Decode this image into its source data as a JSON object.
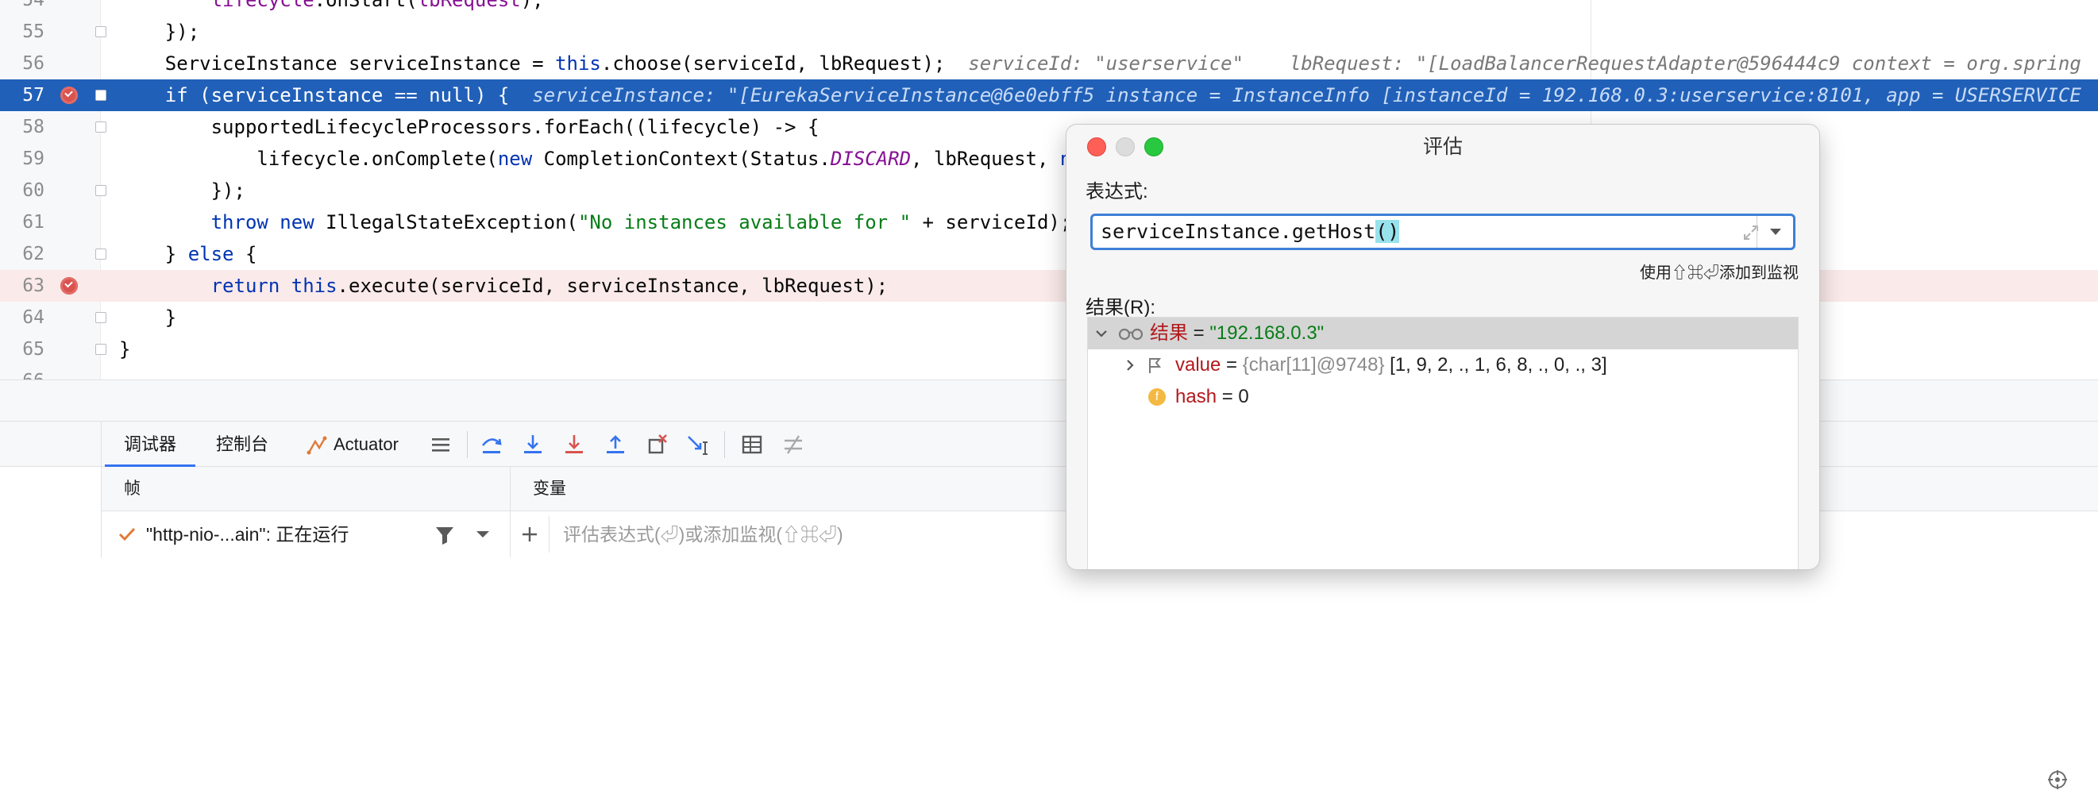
{
  "editor": {
    "lines": [
      {
        "num": "54",
        "code_html": "        <span class=\"var\">lifecycle</span>.onStart(<span class=\"var\">lbRequest</span>);"
      },
      {
        "num": "55",
        "code_html": "    });"
      },
      {
        "num": "56",
        "code_html": "    ServiceInstance serviceInstance = <span class=\"kw\">this</span>.choose(serviceId, lbRequest);  <span class=\"inline-hint\">serviceId: \"userservice\"    lbRequest: \"[LoadBalancerRequestAdapter@596444c9 context = org.spring</span>"
      },
      {
        "num": "57",
        "code_html": "    <span class=\"kw\">if</span> (serviceInstance == <span class=\"kw\">null</span>) {  <span class=\"inline-hint\">serviceInstance: \"[EurekaServiceInstance@6e0ebff5 instance = InstanceInfo [instanceId = 192.168.0.3:userservice:8101, app = USERSERVICE</span>"
      },
      {
        "num": "58",
        "code_html": "        supportedLifecycleProcessors.forEach((lifecycle) -> {"
      },
      {
        "num": "59",
        "code_html": "            lifecycle.onComplete(<span class=\"kw\">new</span> CompletionContext(Status.<span class=\"field\">DISCARD</span>, lbRequest, <span class=\"kw\">new</span> EmptyResponse()));"
      },
      {
        "num": "60",
        "code_html": "        });"
      },
      {
        "num": "61",
        "code_html": "        <span class=\"kw\">throw new</span> IllegalStateException(<span class=\"str\">\"No instances available for \"</span> + serviceId);"
      },
      {
        "num": "62",
        "code_html": "    } <span class=\"kw\">else</span> {"
      },
      {
        "num": "63",
        "code_html": "        <span class=\"kw\">return this</span>.execute(serviceId, serviceInstance, lbRequest);"
      },
      {
        "num": "64",
        "code_html": "    }"
      },
      {
        "num": "65",
        "code_html": "}"
      },
      {
        "num": "66",
        "code_html": ""
      }
    ]
  },
  "debug_tabs": {
    "debugger": "调试器",
    "console": "控制台",
    "actuator": "Actuator"
  },
  "frames": {
    "title": "帧",
    "thread_label": "\"http-nio-...ain\": 正在运行"
  },
  "variables": {
    "title": "变量",
    "placeholder": "评估表达式(⏎)或添加监视(⇧⌘⏎)"
  },
  "dialog": {
    "title": "评估",
    "expression_label": "表达式:",
    "expression_prefix": "serviceInstance.getHost",
    "expression_parens": "()",
    "shortcut_hint": "使用⇧⌘⏎添加到监视",
    "result_label": "结果(R):",
    "result": {
      "name": "结果",
      "value": "\"192.168.0.3\"",
      "children": [
        {
          "name": "value",
          "type": "{char[11]@9748}",
          "value": "[1, 9, 2, ., 1, 6, 8, ., 0, ., 3]"
        },
        {
          "name": "hash",
          "value": "0"
        }
      ]
    }
  },
  "colors": {
    "current_line": "#2160b8",
    "breakpoint": "#d9534f",
    "accent": "#3574f0"
  }
}
